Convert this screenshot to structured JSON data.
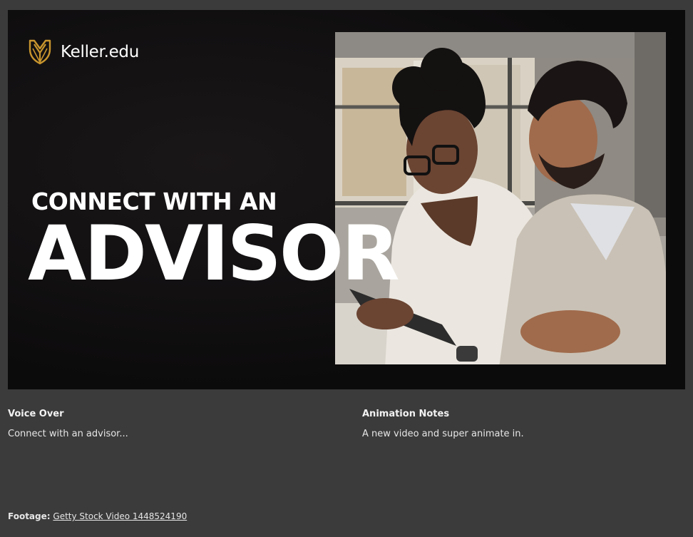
{
  "slide": {
    "brand": {
      "logo_icon": "shield-crest-icon",
      "name": "Keller.edu",
      "accent_color": "#c8952e"
    },
    "headline_small": "CONNECT WITH AN",
    "headline_big": "ADVISOR",
    "photo": {
      "description_icon": "two-people-with-tablet-photo"
    }
  },
  "notes": {
    "voice_over": {
      "heading": "Voice Over",
      "text": "Connect with an advisor..."
    },
    "animation_notes": {
      "heading": "Animation Notes",
      "text": "A new video and super animate in."
    }
  },
  "footage": {
    "label": "Footage:",
    "link_text": "Getty Stock Video 1448524190"
  }
}
